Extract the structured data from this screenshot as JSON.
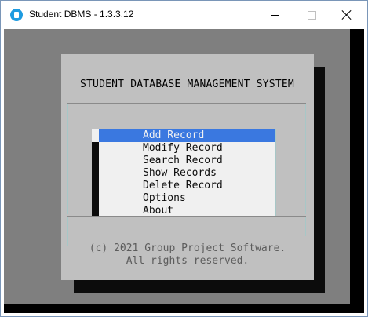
{
  "window": {
    "title": "Student DBMS - 1.3.3.12"
  },
  "dialog": {
    "title": "STUDENT DATABASE MANAGEMENT SYSTEM",
    "footer_line1": "(c) 2021 Group Project Software.",
    "footer_line2": "All rights reserved."
  },
  "menu": {
    "items": [
      {
        "label": "Add Record",
        "selected": true
      },
      {
        "label": "Modify Record"
      },
      {
        "label": "Search Record"
      },
      {
        "label": "Show Records"
      },
      {
        "label": "Delete Record"
      },
      {
        "label": "Options"
      },
      {
        "label": "About"
      }
    ]
  },
  "colors": {
    "selection": "#3a78e0",
    "console_gray": "#7f7f7f",
    "dialog_bg": "#c0c0c0",
    "menu_bg": "#f0f0f0"
  },
  "icons": {
    "app": "app-icon",
    "minimize": "minimize-icon",
    "maximize": "maximize-icon",
    "close": "close-icon"
  }
}
